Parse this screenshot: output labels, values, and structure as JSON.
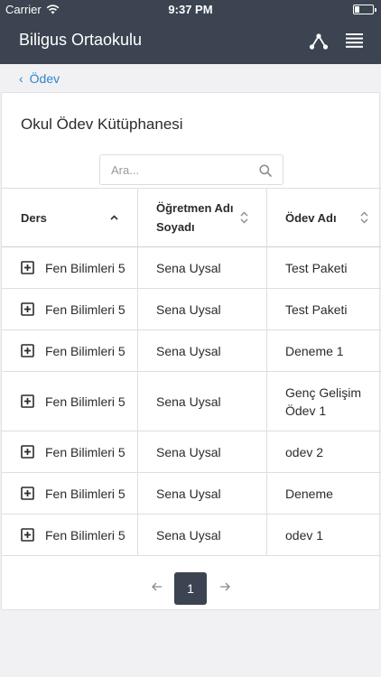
{
  "status_bar": {
    "carrier": "Carrier",
    "time": "9:37 PM"
  },
  "app_bar": {
    "title": "Biligus Ortaokulu"
  },
  "breadcrumb": {
    "label": "Ödev"
  },
  "card": {
    "title": "Okul Ödev Kütüphanesi",
    "search_placeholder": "Ara..."
  },
  "table": {
    "columns": [
      "Ders",
      "Öğretmen Adı Soyadı",
      "Ödev Adı"
    ],
    "rows": [
      {
        "ders": "Fen Bilimleri 5",
        "ogretmen": "Sena Uysal",
        "odev": "Test Paketi"
      },
      {
        "ders": "Fen Bilimleri 5",
        "ogretmen": "Sena Uysal",
        "odev": "Test Paketi"
      },
      {
        "ders": "Fen Bilimleri 5",
        "ogretmen": "Sena Uysal",
        "odev": "Deneme 1"
      },
      {
        "ders": "Fen Bilimleri 5",
        "ogretmen": "Sena Uysal",
        "odev": "Genç Gelişim Ödev 1"
      },
      {
        "ders": "Fen Bilimleri 5",
        "ogretmen": "Sena Uysal",
        "odev": "odev 2"
      },
      {
        "ders": "Fen Bilimleri 5",
        "ogretmen": "Sena Uysal",
        "odev": "Deneme"
      },
      {
        "ders": "Fen Bilimleri 5",
        "ogretmen": "Sena Uysal",
        "odev": "odev 1"
      }
    ]
  },
  "pagination": {
    "current_page": "1"
  },
  "icons": {
    "wifi": "wifi-icon",
    "battery": "battery-icon",
    "share": "share-network-icon",
    "menu": "list-menu-icon",
    "back": "chevron-left-icon",
    "search": "search-icon",
    "sort_asc": "chevron-up-icon",
    "sort_both": "sort-updown-icon",
    "expand": "plus-square-icon",
    "prev": "arrow-left-icon",
    "next": "arrow-right-icon"
  },
  "colors": {
    "header_bg": "#3b4450",
    "link": "#2e86c9",
    "page_bg": "#f1f1f3"
  }
}
